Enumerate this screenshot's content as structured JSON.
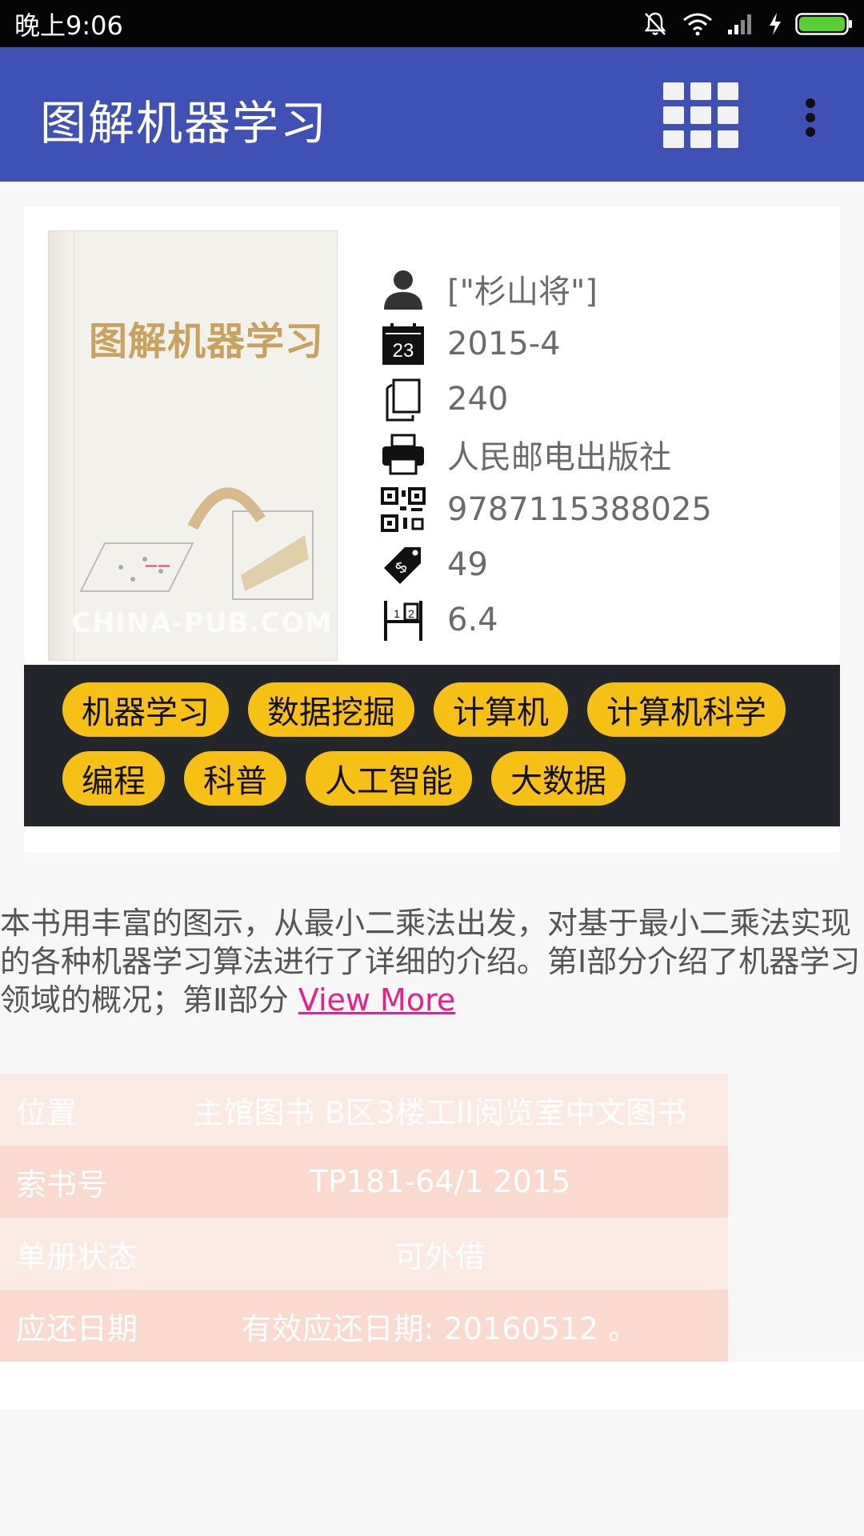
{
  "status_bar": {
    "time": "晚上9:06",
    "icons": [
      "bell-muted-icon",
      "wifi-icon",
      "signal-icon",
      "charging-icon",
      "battery-icon"
    ]
  },
  "app_bar": {
    "title": "图解机器学习",
    "grid_icon": "grid-view-icon",
    "more_icon": "more-vert-icon",
    "color": "#3f51b5"
  },
  "book": {
    "cover": {
      "title": "图解机器学习",
      "watermark": "CHINA-PUB.COM"
    },
    "author": "[\"杉山将\"]",
    "date": "2015-4",
    "calendar_day": "23",
    "pages": "240",
    "publisher": "人民邮电出版社",
    "isbn": "9787115388025",
    "price": "49",
    "rating": "6.4"
  },
  "tags": {
    "row1": [
      "机器学习",
      "数据挖掘",
      "计算机",
      "计算机科学"
    ],
    "row2": [
      "编程",
      "科普",
      "人工智能",
      "大数据"
    ],
    "color": "#f6c114",
    "panel_color": "#22262a"
  },
  "description": {
    "text": "本书用丰富的图示，从最小二乘法出发，对基于最小二乘法实现的各种机器学习算法进行了详细的介绍。第Ⅰ部分介绍了机器学习领域的概况；第Ⅱ部分 ",
    "more_link": "View More"
  },
  "holdings": [
    {
      "label": "位置",
      "value": "主馆图书 B区3楼工II阅览室中文图书"
    },
    {
      "label": "索书号",
      "value": "TP181-64/1 2015"
    },
    {
      "label": "单册状态",
      "value": "可外借"
    },
    {
      "label": "应还日期",
      "value": "有效应还日期: 20160512 。"
    }
  ]
}
